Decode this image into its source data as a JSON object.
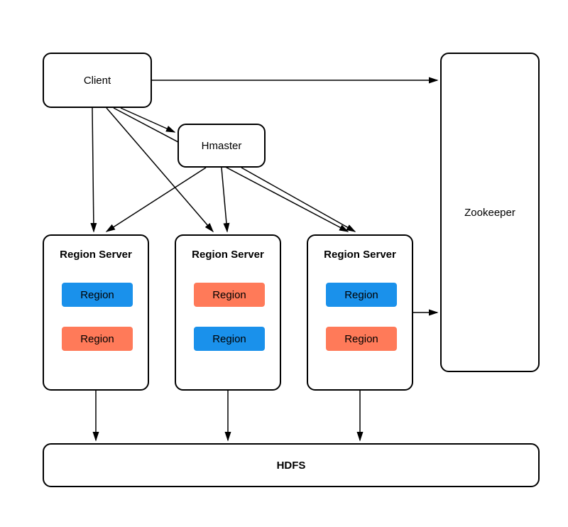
{
  "nodes": {
    "client": "Client",
    "hmaster": "Hmaster",
    "zookeeper": "Zookeeper",
    "region_servers": [
      {
        "title": "Region Server",
        "regions": [
          {
            "label": "Region",
            "color": "blue"
          },
          {
            "label": "Region",
            "color": "orange"
          }
        ]
      },
      {
        "title": "Region Server",
        "regions": [
          {
            "label": "Region",
            "color": "orange"
          },
          {
            "label": "Region",
            "color": "blue"
          }
        ]
      },
      {
        "title": "Region Server",
        "regions": [
          {
            "label": "Region",
            "color": "blue"
          },
          {
            "label": "Region",
            "color": "orange"
          }
        ]
      }
    ],
    "hdfs": "HDFS"
  },
  "colors": {
    "blue": "#1A91EB",
    "orange": "#FF7A59",
    "stroke": "#000000"
  },
  "edges_description": [
    "Client -> Zookeeper",
    "Client -> Hmaster",
    "Client -> RegionServer1",
    "Client -> RegionServer2",
    "Client -> RegionServer3",
    "Hmaster -> RegionServer1",
    "Hmaster -> RegionServer2",
    "Hmaster -> RegionServer3",
    "RegionServer3 -> Zookeeper (bidirectional implied by arrow from RS3 side)",
    "RegionServer1 -> HDFS",
    "RegionServer2 -> HDFS",
    "RegionServer3 -> HDFS"
  ]
}
